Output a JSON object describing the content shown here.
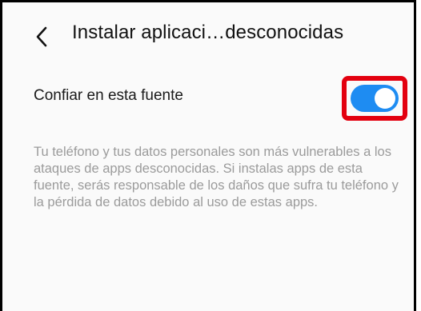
{
  "header": {
    "back_icon": "chevron-left-icon",
    "title": "Instalar aplicaci…desconocidas"
  },
  "setting": {
    "label": "Confiar en esta fuente",
    "toggle_state": "on",
    "toggle_color": "#1e8cf2",
    "highlight_color": "#e3000f"
  },
  "description": {
    "text": "Tu teléfono y tus datos personales son más vulnerables a los ataques de apps desconocidas. Si instalas apps de esta fuente, serás responsable de los daños que sufra tu teléfono y la pérdida de datos debido al uso de estas apps."
  }
}
